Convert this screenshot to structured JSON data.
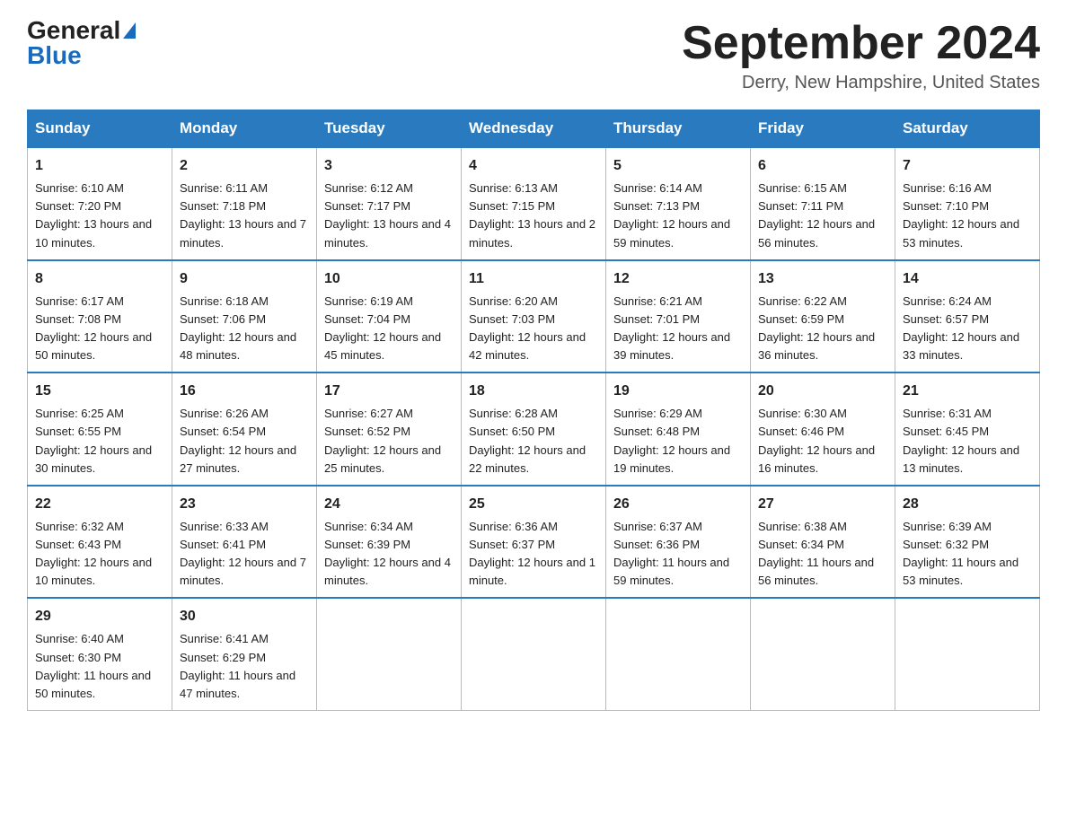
{
  "header": {
    "logo_top": "General",
    "logo_bottom": "Blue",
    "month_title": "September 2024",
    "location": "Derry, New Hampshire, United States"
  },
  "days_of_week": [
    "Sunday",
    "Monday",
    "Tuesday",
    "Wednesday",
    "Thursday",
    "Friday",
    "Saturday"
  ],
  "weeks": [
    [
      {
        "day": "1",
        "sunrise": "6:10 AM",
        "sunset": "7:20 PM",
        "daylight": "13 hours and 10 minutes."
      },
      {
        "day": "2",
        "sunrise": "6:11 AM",
        "sunset": "7:18 PM",
        "daylight": "13 hours and 7 minutes."
      },
      {
        "day": "3",
        "sunrise": "6:12 AM",
        "sunset": "7:17 PM",
        "daylight": "13 hours and 4 minutes."
      },
      {
        "day": "4",
        "sunrise": "6:13 AM",
        "sunset": "7:15 PM",
        "daylight": "13 hours and 2 minutes."
      },
      {
        "day": "5",
        "sunrise": "6:14 AM",
        "sunset": "7:13 PM",
        "daylight": "12 hours and 59 minutes."
      },
      {
        "day": "6",
        "sunrise": "6:15 AM",
        "sunset": "7:11 PM",
        "daylight": "12 hours and 56 minutes."
      },
      {
        "day": "7",
        "sunrise": "6:16 AM",
        "sunset": "7:10 PM",
        "daylight": "12 hours and 53 minutes."
      }
    ],
    [
      {
        "day": "8",
        "sunrise": "6:17 AM",
        "sunset": "7:08 PM",
        "daylight": "12 hours and 50 minutes."
      },
      {
        "day": "9",
        "sunrise": "6:18 AM",
        "sunset": "7:06 PM",
        "daylight": "12 hours and 48 minutes."
      },
      {
        "day": "10",
        "sunrise": "6:19 AM",
        "sunset": "7:04 PM",
        "daylight": "12 hours and 45 minutes."
      },
      {
        "day": "11",
        "sunrise": "6:20 AM",
        "sunset": "7:03 PM",
        "daylight": "12 hours and 42 minutes."
      },
      {
        "day": "12",
        "sunrise": "6:21 AM",
        "sunset": "7:01 PM",
        "daylight": "12 hours and 39 minutes."
      },
      {
        "day": "13",
        "sunrise": "6:22 AM",
        "sunset": "6:59 PM",
        "daylight": "12 hours and 36 minutes."
      },
      {
        "day": "14",
        "sunrise": "6:24 AM",
        "sunset": "6:57 PM",
        "daylight": "12 hours and 33 minutes."
      }
    ],
    [
      {
        "day": "15",
        "sunrise": "6:25 AM",
        "sunset": "6:55 PM",
        "daylight": "12 hours and 30 minutes."
      },
      {
        "day": "16",
        "sunrise": "6:26 AM",
        "sunset": "6:54 PM",
        "daylight": "12 hours and 27 minutes."
      },
      {
        "day": "17",
        "sunrise": "6:27 AM",
        "sunset": "6:52 PM",
        "daylight": "12 hours and 25 minutes."
      },
      {
        "day": "18",
        "sunrise": "6:28 AM",
        "sunset": "6:50 PM",
        "daylight": "12 hours and 22 minutes."
      },
      {
        "day": "19",
        "sunrise": "6:29 AM",
        "sunset": "6:48 PM",
        "daylight": "12 hours and 19 minutes."
      },
      {
        "day": "20",
        "sunrise": "6:30 AM",
        "sunset": "6:46 PM",
        "daylight": "12 hours and 16 minutes."
      },
      {
        "day": "21",
        "sunrise": "6:31 AM",
        "sunset": "6:45 PM",
        "daylight": "12 hours and 13 minutes."
      }
    ],
    [
      {
        "day": "22",
        "sunrise": "6:32 AM",
        "sunset": "6:43 PM",
        "daylight": "12 hours and 10 minutes."
      },
      {
        "day": "23",
        "sunrise": "6:33 AM",
        "sunset": "6:41 PM",
        "daylight": "12 hours and 7 minutes."
      },
      {
        "day": "24",
        "sunrise": "6:34 AM",
        "sunset": "6:39 PM",
        "daylight": "12 hours and 4 minutes."
      },
      {
        "day": "25",
        "sunrise": "6:36 AM",
        "sunset": "6:37 PM",
        "daylight": "12 hours and 1 minute."
      },
      {
        "day": "26",
        "sunrise": "6:37 AM",
        "sunset": "6:36 PM",
        "daylight": "11 hours and 59 minutes."
      },
      {
        "day": "27",
        "sunrise": "6:38 AM",
        "sunset": "6:34 PM",
        "daylight": "11 hours and 56 minutes."
      },
      {
        "day": "28",
        "sunrise": "6:39 AM",
        "sunset": "6:32 PM",
        "daylight": "11 hours and 53 minutes."
      }
    ],
    [
      {
        "day": "29",
        "sunrise": "6:40 AM",
        "sunset": "6:30 PM",
        "daylight": "11 hours and 50 minutes."
      },
      {
        "day": "30",
        "sunrise": "6:41 AM",
        "sunset": "6:29 PM",
        "daylight": "11 hours and 47 minutes."
      },
      null,
      null,
      null,
      null,
      null
    ]
  ]
}
